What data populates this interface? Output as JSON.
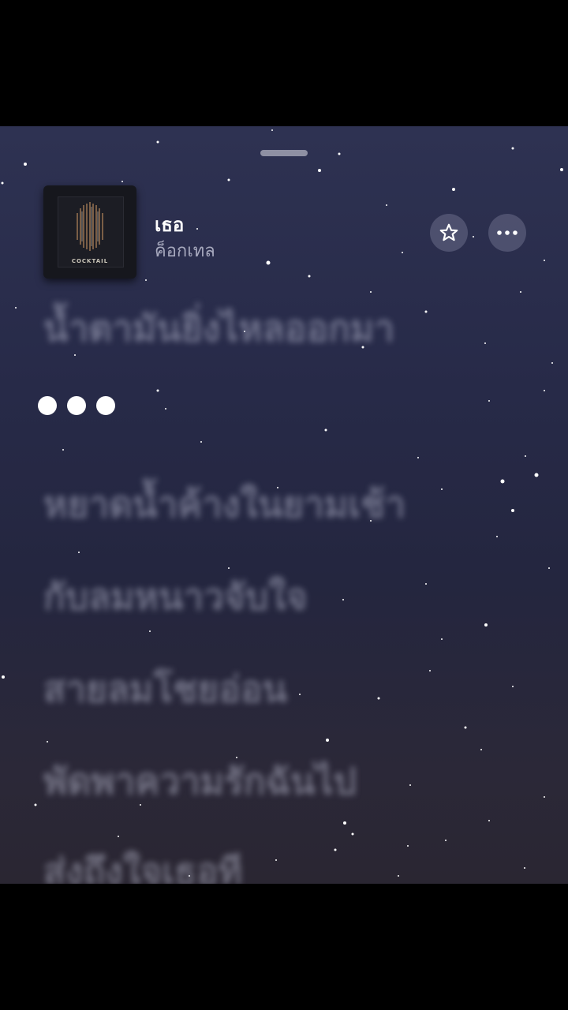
{
  "player": {
    "track_title": "เธอ",
    "artist": "ค็อกเทล",
    "artwork_label": "COCKTAIL",
    "favorite_icon": "star-icon",
    "more_icon": "ellipsis-icon"
  },
  "lyrics": {
    "previous_line": "น้ำตามันยิ่งไหลออกมา",
    "upcoming_lines": [
      "หยาดน้ำค้างในยามเช้า",
      "กับลมหนาวจับใจ",
      "สายลมโชยอ่อน",
      "พัดพาความรักฉันไป",
      "ส่งถึงใจเธอที"
    ]
  },
  "colors": {
    "background_top": "#2e3252",
    "background_bottom": "#2a2632",
    "text_primary": "#ffffff",
    "text_secondary": "#a6a8bd"
  }
}
